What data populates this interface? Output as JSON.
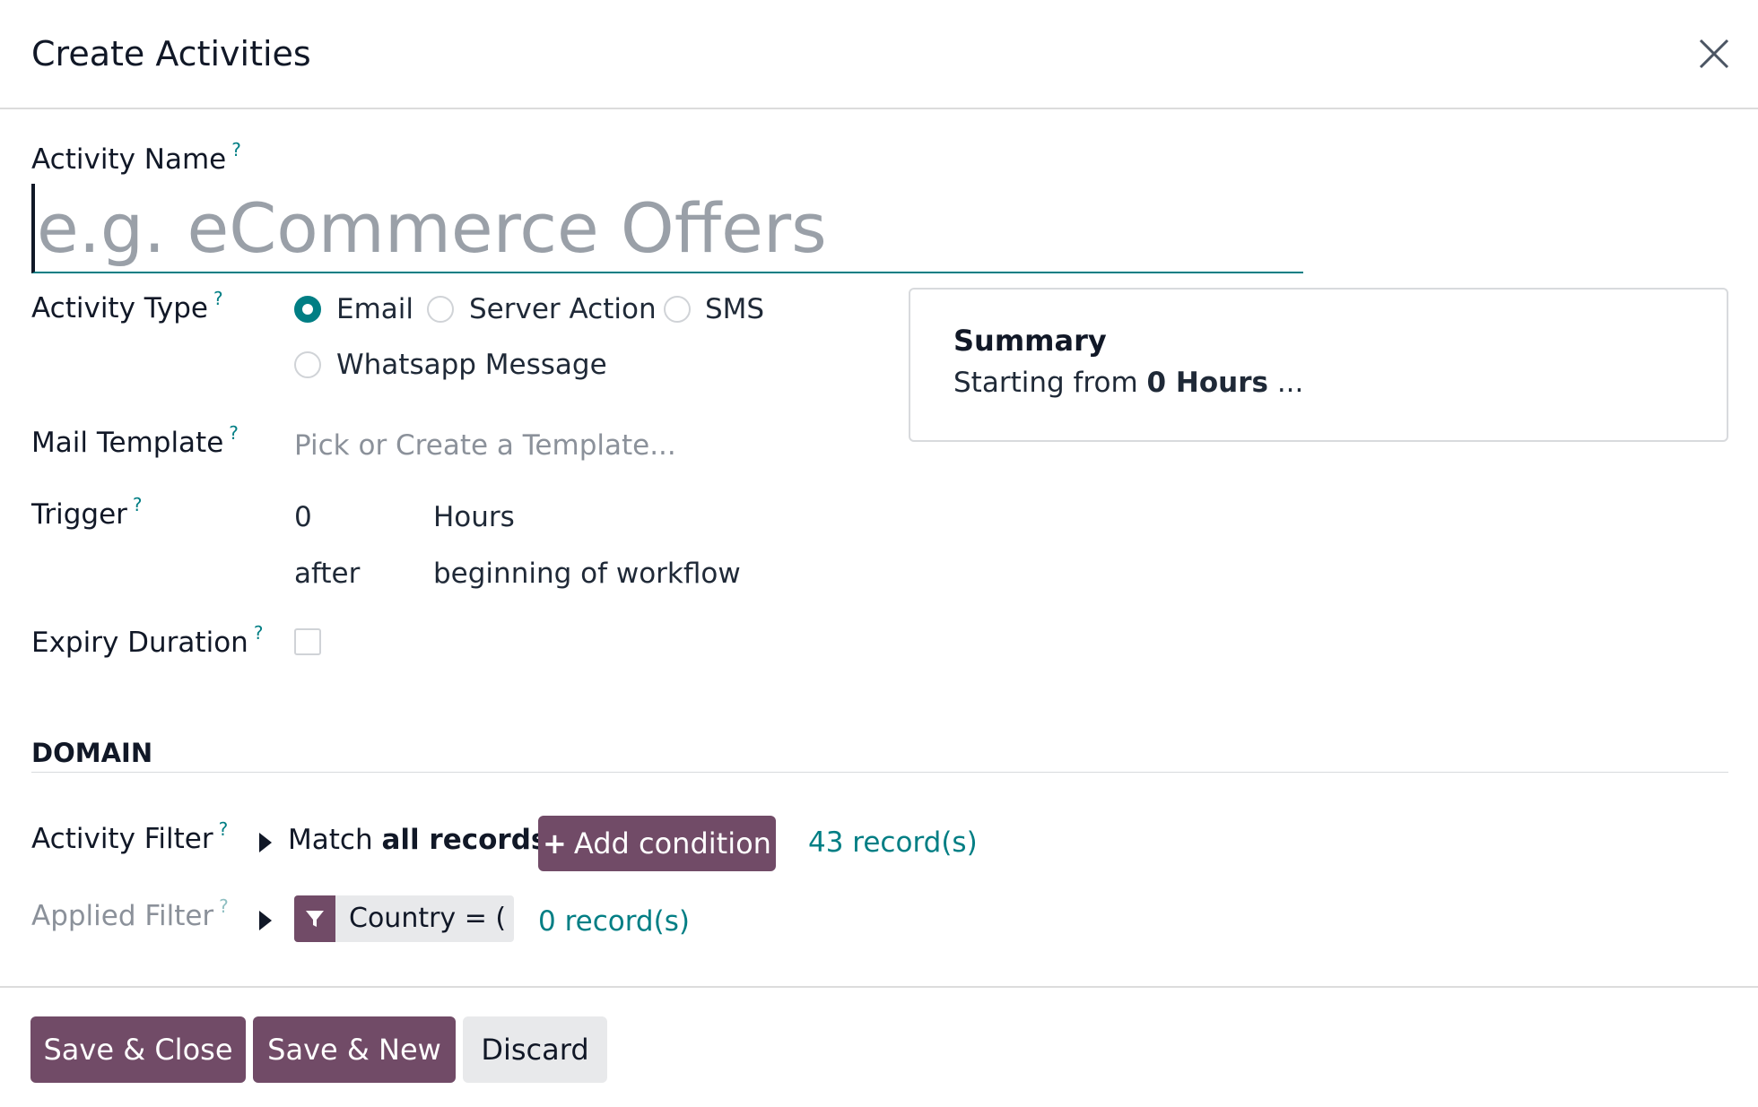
{
  "dialog": {
    "title": "Create Activities",
    "close_icon": "close-icon"
  },
  "fields": {
    "activity_name": {
      "label": "Activity Name",
      "help": "?",
      "placeholder": "e.g. eCommerce Offers",
      "value": ""
    },
    "activity_type": {
      "label": "Activity Type",
      "help": "?",
      "options": [
        "Email",
        "Server Action",
        "SMS",
        "Whatsapp Message"
      ],
      "selected": "Email"
    },
    "mail_template": {
      "label": "Mail Template",
      "help": "?",
      "placeholder": "Pick or Create a Template..."
    },
    "trigger": {
      "label": "Trigger",
      "help": "?",
      "interval": "0",
      "unit": "Hours",
      "when": "after",
      "event": "beginning of workflow"
    },
    "expiry_duration": {
      "label": "Expiry Duration",
      "help": "?",
      "checked": false
    }
  },
  "summary": {
    "title": "Summary",
    "prefix": "Starting from",
    "value": "0 Hours",
    "suffix": "..."
  },
  "domain": {
    "section_title": "DOMAIN",
    "activity_filter": {
      "label": "Activity Filter",
      "help": "?",
      "match_prefix": "Match",
      "match_value": "all records",
      "add_condition": "Add condition",
      "records": "43 record(s)"
    },
    "applied_filter": {
      "label": "Applied Filter",
      "help": "?",
      "tag": "Country = ( )",
      "records": "0 record(s)"
    }
  },
  "footer": {
    "save_close": "Save & Close",
    "save_new": "Save & New",
    "discard": "Discard"
  },
  "colors": {
    "primary": "#714b67",
    "accent": "#017e84"
  }
}
